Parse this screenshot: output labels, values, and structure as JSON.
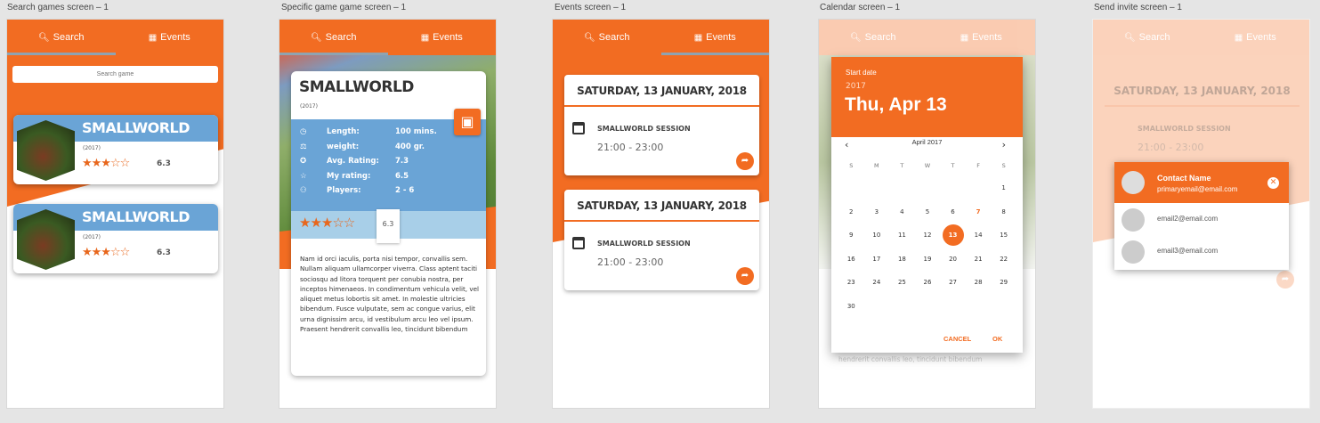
{
  "labels": [
    "Search games screen – 1",
    "Specific game game screen – 1",
    "Events screen – 1",
    "Calendar screen – 1",
    "Send invite screen – 1"
  ],
  "tabs": {
    "search": "Search",
    "events": "Events"
  },
  "search": {
    "placeholder": "Search game",
    "games": [
      {
        "title": "SMALLWORLD",
        "year": "(2017)",
        "stars": "★★★☆☆",
        "rating": "6.3"
      },
      {
        "title": "SMALLWORLD",
        "year": "(2017)",
        "stars": "★★★☆☆",
        "rating": "6.3"
      }
    ]
  },
  "detail": {
    "title": "SMALLWORLD",
    "year": "(2017)",
    "stats": [
      {
        "icon": "clock-icon",
        "k": "Length:",
        "v": "100 mins."
      },
      {
        "icon": "weight-icon",
        "k": "weight:",
        "v": "400 gr."
      },
      {
        "icon": "star-badge-icon",
        "k": "Avg. Rating:",
        "v": "7.3"
      },
      {
        "icon": "star-outline-icon",
        "k": "My rating:",
        "v": "6.5"
      },
      {
        "icon": "players-icon",
        "k": "Players:",
        "v": "2 - 6"
      }
    ],
    "stars": "★★★☆☆",
    "rating": "6.3",
    "description": "Nam id orci iaculis, porta nisi tempor, convallis sem. Nullam aliquam ullamcorper viverra. Class aptent taciti sociosqu ad litora torquent per conubia nostra, per inceptos himenaeos. In condimentum vehicula velit, vel aliquet metus lobortis sit amet. In molestie ultricies bibendum. Fusce vulputate, sem ac congue varius, elit urna dignissim arcu, id vestibulum arcu leo vel ipsum. Praesent hendrerit convallis leo, tincidunt bibendum"
  },
  "events": [
    {
      "date": "SATURDAY, 13 JANUARY, 2018",
      "session": "SMALLWORLD SESSION",
      "time": "21:00 - 23:00"
    },
    {
      "date": "SATURDAY, 13 JANUARY, 2018",
      "session": "SMALLWORLD SESSION",
      "time": "21:00 - 23:00"
    }
  ],
  "calendar": {
    "start_label": "Start date",
    "year": "2017",
    "selected": "Thu, Apr 13",
    "month": "April 2017",
    "weekdays": [
      "S",
      "M",
      "T",
      "W",
      "T",
      "F",
      "S"
    ],
    "weeks": [
      [
        "",
        "",
        "",
        "",
        "",
        "",
        "1"
      ],
      [
        "2",
        "3",
        "4",
        "5",
        "6",
        "7",
        "8"
      ],
      [
        "9",
        "10",
        "11",
        "12",
        "13",
        "14",
        "15"
      ],
      [
        "16",
        "17",
        "18",
        "19",
        "20",
        "21",
        "22"
      ],
      [
        "23",
        "24",
        "25",
        "26",
        "27",
        "28",
        "29"
      ],
      [
        "30",
        "",
        "",
        "",
        "",
        "",
        ""
      ]
    ],
    "selected_day": "13",
    "today_day": "7",
    "cancel": "CANCEL",
    "ok": "OK",
    "behind_text": "hendrerit convallis leo, tincidunt bibendum"
  },
  "invite": {
    "contact_name": "Contact Name",
    "primary": "primaryemail@email.com",
    "emails": [
      "email2@email.com",
      "email3@email.com"
    ],
    "bg_date": "SATURDAY, 13 JANUARY, 2018",
    "bg_session": "SMALLWORLD SESSION",
    "bg_time": "21:00 - 23:00"
  },
  "colors": {
    "accent": "#f26c22",
    "blue": "#6aa4d6"
  }
}
